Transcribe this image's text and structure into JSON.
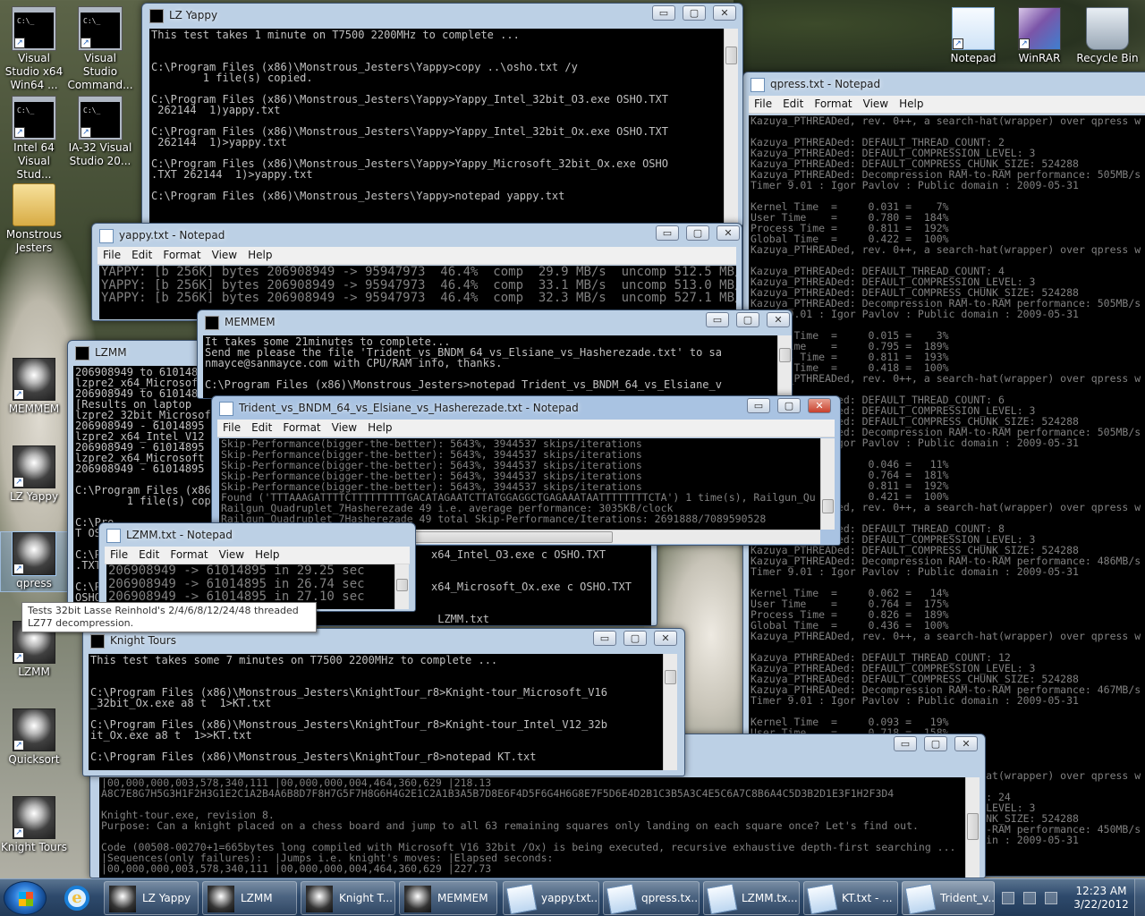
{
  "desktop": {
    "icons_left": [
      {
        "label": "Visual Studio x64 Win64 ...",
        "kind": "cmd"
      },
      {
        "label": "Visual Studio Command...",
        "kind": "cmd"
      },
      {
        "label": "Intel 64 Visual Stud...",
        "kind": "cmd"
      },
      {
        "label": "IA-32 Visual Studio 20...",
        "kind": "cmd"
      },
      {
        "label": "Monstrous Jesters",
        "kind": "folder"
      },
      {
        "label": "MEMMEM",
        "kind": "jester"
      },
      {
        "label": "LZ Yappy",
        "kind": "jester"
      },
      {
        "label": "qpress",
        "kind": "jester"
      },
      {
        "label": "LZMM",
        "kind": "jester"
      },
      {
        "label": "Quicksort",
        "kind": "jester"
      },
      {
        "label": "Knight Tours",
        "kind": "jester"
      }
    ],
    "icons_right": [
      {
        "label": "Notepad",
        "kind": "note"
      },
      {
        "label": "WinRAR",
        "kind": "rar"
      },
      {
        "label": "Recycle Bin",
        "kind": "bin"
      }
    ],
    "tooltip": "Tests 32bit Lasse Reinhold's 2/4/6/8/12/24/48 threaded LZ77 decompression."
  },
  "caption_buttons": {
    "minimize": "▭",
    "maximize": "▢",
    "close": "✕"
  },
  "notepad_menu": [
    "File",
    "Edit",
    "Format",
    "View",
    "Help"
  ],
  "windows": {
    "lz_yappy": {
      "title": "LZ Yappy",
      "text": "This test takes 1 minute on T7500 2200MHz to complete ...\n\n\nC:\\Program Files (x86)\\Monstrous_Jesters\\Yappy>copy ..\\osho.txt /y\n        1 file(s) copied.\n\nC:\\Program Files (x86)\\Monstrous_Jesters\\Yappy>Yappy_Intel_32bit_O3.exe OSHO.TXT\n 262144  1)yappy.txt\n\nC:\\Program Files (x86)\\Monstrous_Jesters\\Yappy>Yappy_Intel_32bit_Ox.exe OSHO.TXT\n 262144  1)>yappy.txt\n\nC:\\Program Files (x86)\\Monstrous_Jesters\\Yappy>Yappy_Microsoft_32bit_Ox.exe OSHO\n.TXT 262144  1)>yappy.txt\n\nC:\\Program Files (x86)\\Monstrous_Jesters\\Yappy>notepad yappy.txt"
    },
    "qpress_notepad": {
      "title": "qpress.txt - Notepad",
      "text": "Kazuya_PTHREADed, rev. 0++, a search-hat(wrapper) over qpress w\n\nKazuya_PTHREADed: DEFAULT_THREAD_COUNT: 2\nKazuya_PTHREADed: DEFAULT_COMPRESSION_LEVEL: 3\nKazuya_PTHREADed: DEFAULT_COMPRESS_CHUNK_SIZE: 524288\nKazuya_PTHREADed: Decompression RAM-to-RAM performance: 505MB/s\nTimer 9.01 : Igor Pavlov : Public domain : 2009-05-31\n\nKernel Time  =     0.031 =    7%\nUser Time    =     0.780 =  184%\nProcess Time =     0.811 =  192%\nGlobal Time  =     0.422 =  100%\nKazuya_PTHREADed, rev. 0++, a search-hat(wrapper) over qpress w\n\nKazuya_PTHREADed: DEFAULT_THREAD_COUNT: 4\nKazuya_PTHREADed: DEFAULT_COMPRESSION_LEVEL: 3\nKazuya_PTHREADed: DEFAULT_COMPRESS_CHUNK_SIZE: 524288\nKazuya_PTHREADed: Decompression RAM-to-RAM performance: 505MB/s\nTimer 9.01 : Igor Pavlov : Public domain : 2009-05-31\n\nKernel Time  =     0.015 =    3%\nUser Time    =     0.795 =  189%\nProcess Time =     0.811 =  193%\nGlobal Time  =     0.418 =  100%\nKazuya_PTHREADed, rev. 0++, a search-hat(wrapper) over qpress w\n\nKazuya_PTHREADed: DEFAULT_THREAD_COUNT: 6\nKazuya_PTHREADed: DEFAULT_COMPRESSION_LEVEL: 3\nKazuya_PTHREADed: DEFAULT_COMPRESS_CHUNK_SIZE: 524288\nKazuya_PTHREADed: Decompression RAM-to-RAM performance: 505MB/s\nTimer 9.01 : Igor Pavlov : Public domain : 2009-05-31\n\nKernel Time  =     0.046 =   11%\nUser Time    =     0.764 =  181%\nProcess Time =     0.811 =  192%\nGlobal Time  =     0.421 =  100%\nKazuya_PTHREADed, rev. 0++, a search-hat(wrapper) over qpress w\n\nKazuya_PTHREADed: DEFAULT_THREAD_COUNT: 8\nKazuya_PTHREADed: DEFAULT_COMPRESSION_LEVEL: 3\nKazuya_PTHREADed: DEFAULT_COMPRESS_CHUNK_SIZE: 524288\nKazuya_PTHREADed: Decompression RAM-to-RAM performance: 486MB/s\nTimer 9.01 : Igor Pavlov : Public domain : 2009-05-31\n\nKernel Time  =     0.062 =   14%\nUser Time    =     0.764 =  175%\nProcess Time =     0.826 =  189%\nGlobal Time  =     0.436 =  100%\nKazuya_PTHREADed, rev. 0++, a search-hat(wrapper) over qpress w\n\nKazuya_PTHREADed: DEFAULT_THREAD_COUNT: 12\nKazuya_PTHREADed: DEFAULT_COMPRESSION_LEVEL: 3\nKazuya_PTHREADed: DEFAULT_COMPRESS_CHUNK_SIZE: 524288\nKazuya_PTHREADed: Decompression RAM-to-RAM performance: 467MB/s\nTimer 9.01 : Igor Pavlov : Public domain : 2009-05-31\n\nKernel Time  =     0.093 =   19%\nUser Time    =     0.718 =  158%\n\n\n\nKazuya_PTHREADed, rev. 0++, a search-hat(wrapper) over qpress w\n\nKazuya_PTHREADed: DEFAULT_THREAD_COUNT: 24\nKazuya_PTHREADed: DEFAULT_COMPRESSION_LEVEL: 3\nKazuya_PTHREADed: DEFAULT_COMPRESS_CHUNK_SIZE: 524288\nKazuya_PTHREADed: Decompression RAM-to-RAM performance: 450MB/s\nTimer 9.01 : Igor Pavlov : Public domain : 2009-05-31"
    },
    "yappy_notepad": {
      "title": "yappy.txt - Notepad",
      "text": "YAPPY: [b 256K] bytes 206908949 -> 95947973  46.4%  comp  29.9 MB/s  uncomp 512.5 MB/s\nYAPPY: [b 256K] bytes 206908949 -> 95947973  46.4%  comp  33.1 MB/s  uncomp 513.0 MB/s\nYAPPY: [b 256K] bytes 206908949 -> 95947973  46.4%  comp  32.3 MB/s  uncomp 527.1 MB/s"
    },
    "lzmm": {
      "title": "LZMM",
      "text": "206908949 to 61014895\nlzpre2_x64_Microsoft\n206908949 to 61014895\n[Results on laptop\nlzpre2_32bit_Microsof\n206908949 - 61014895\nlzpre2_x64_Intel_V12\n206908949 - 61014895\nlzpre2_x64_Microsoft\n206908949 - 61014895\n\nC:\\Program Files (x86)\n        1 file(s) copied.\n\nC:\\Pro\nT OSHO\n\nC:\\Pro\n.TXT\n\nC:\\Pro\nOSHO."
    },
    "memmem": {
      "title": "MEMMEM",
      "text": "It takes some 21minutes to complete...\nSend me please the file 'Trident_vs_BNDM_64_vs_Elsiane_vs_Hasherezade.txt' to sa\nnmayce@sanmayce.com with CPU/RAM info, thanks.\n\nC:\\Program Files (x86)\\Monstrous_Jesters>notepad Trident_vs_BNDM_64_vs_Elsiane_v"
    },
    "trident_notepad": {
      "title": "Trident_vs_BNDM_64_vs_Elsiane_vs_Hasherezade.txt - Notepad",
      "text": "Skip-Performance(bigger-the-better): 5643%, 3944537 skips/iterations\nSkip-Performance(bigger-the-better): 5643%, 3944537 skips/iterations\nSkip-Performance(bigger-the-better): 5643%, 3944537 skips/iterations\nSkip-Performance(bigger-the-better): 5643%, 3944537 skips/iterations\nSkip-Performance(bigger-the-better): 5643%, 3944537 skips/iterations\nFound ('TTTAAAGATTTTCTTTTTTTTTGACATAGAATCTTATGGAGGCTGAGAAATAATTTTTTTTCTA') 1 time(s), Railgun_Qu\nRailgun_Quadruplet_7Hasherezade 49 i.e. average performance: 3035KB/clock\nRailgun_Quadruplet_7Hasherezade 49 total Skip-Performance/Iterations: 2691888/7089590528"
    },
    "lzmm_notepad": {
      "title": "LZMM.txt - Notepad",
      "text": "206908949 -> 61014895 in 29.25 sec\n206908949 -> 61014895 in 26.74 sec\n206908949 -> 61014895 in 27.10 sec"
    },
    "lzmm_console_tail": {
      "text": "x64_Intel_O3.exe c OSHO.TXT\n\n\nx64_Microsoft_Ox.exe c OSHO.TXT\n\n\n LZMM.txt"
    },
    "knight_tours": {
      "title": "Knight Tours",
      "text": "This test takes some 7 minutes on T7500 2200MHz to complete ...\n\n\nC:\\Program Files (x86)\\Monstrous_Jesters\\KnightTour_r8>Knight-tour_Microsoft_V16\n_32bit_Ox.exe a8 t  1>KT.txt\n\nC:\\Program Files (x86)\\Monstrous_Jesters\\KnightTour_r8>Knight-tour_Intel_V12_32b\nit_Ox.exe a8 t  1>>KT.txt\n\nC:\\Program Files (x86)\\Monstrous_Jesters\\KnightTour_r8>notepad KT.txt"
    },
    "kt_notepad": {
      "title": "",
      "text": "|00,000,000,003,578,340,111 |00,000,000,004,464,360,629 |218.13\nA8C7E8G7H5G3H1F2H3G1E2C1A2B4A6B8D7F8H7G5F7H8G6H4G2E1C2A1B3A5B7D8E6F4D5F6G4H6G8E7F5D6E4D2B1C3B5A3C4E5C6A7C8B6A4C5D3B2D1E3F1H2F3D4\n\nKnight-tour.exe, revision 8.\nPurpose: Can a knight placed on a chess board and jump to all 63 remaining squares only landing on each square once? Let's find out.\n\nCode (00508-00270+1=665bytes long compiled with Microsoft V16 32bit /Ox) is being executed, recursive exhaustive depth-first searching ...\n|Sequences(only failures):  |Jumps i.e. knight's moves: |Elapsed seconds:\n|00,000,000,003,578,340,111 |00,000,000,004,464,360,629 |227.73"
    }
  },
  "taskbar": {
    "buttons": [
      {
        "label": "LZ Yappy",
        "kind": "j"
      },
      {
        "label": "LZMM",
        "kind": "j"
      },
      {
        "label": "Knight T...",
        "kind": "j"
      },
      {
        "label": "MEMMEM",
        "kind": "j"
      },
      {
        "label": "yappy.txt...",
        "kind": "n"
      },
      {
        "label": "qpress.tx...",
        "kind": "n"
      },
      {
        "label": "LZMM.tx...",
        "kind": "n"
      },
      {
        "label": "KT.txt - ...",
        "kind": "n"
      },
      {
        "label": "Trident_v...",
        "kind": "n"
      }
    ],
    "time": "12:23 AM",
    "date": "3/22/2012"
  }
}
